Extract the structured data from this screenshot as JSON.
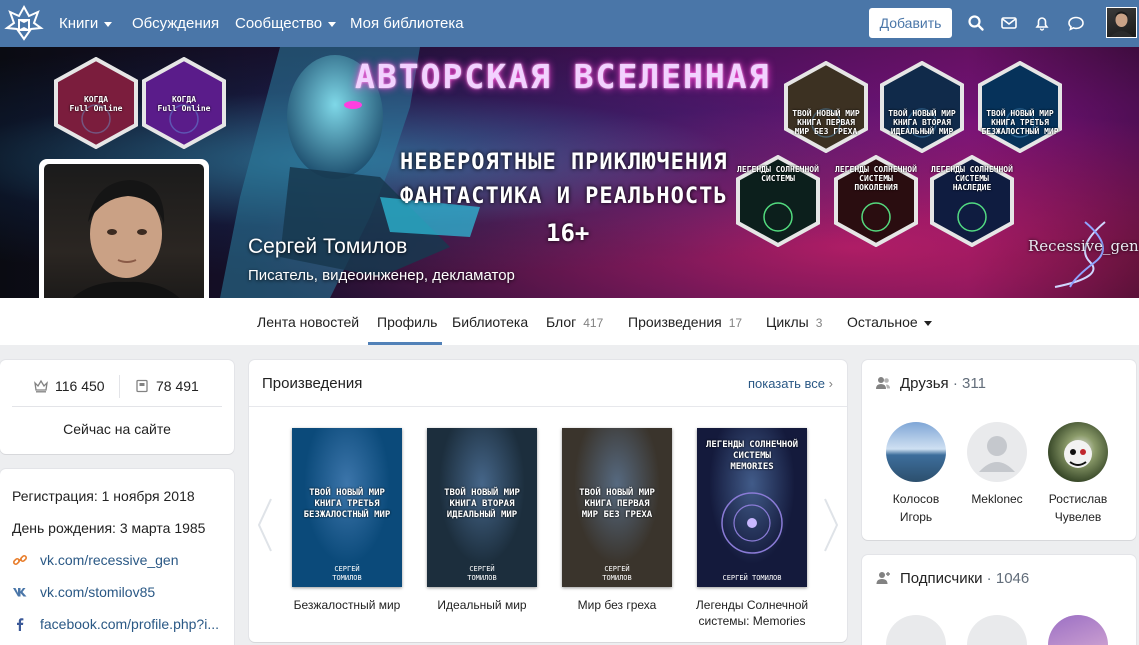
{
  "nav": {
    "items": [
      {
        "label": "Книги",
        "dropdown": true
      },
      {
        "label": "Обсуждения",
        "dropdown": false
      },
      {
        "label": "Сообщество",
        "dropdown": true
      },
      {
        "label": "Моя библиотека",
        "dropdown": false
      }
    ],
    "add_label": "Добавить",
    "icons": [
      "search-icon",
      "mail-icon",
      "bell-icon",
      "chat-icon"
    ]
  },
  "cover": {
    "title": "АВТОРСКАЯ ВСЕЛЕННАЯ",
    "subtitle_1": "НЕВЕРОЯТНЫЕ ПРИКЛЮЧЕНИЯ",
    "subtitle_2": "ФАНТАСТИКА И РЕАЛЬНОСТЬ",
    "age": "16+",
    "watermark": "Recessive_gen",
    "hexes": [
      {
        "label": "КОГДА\nFull Online"
      },
      {
        "label": "КОГДА\nFull Online"
      },
      {
        "label": "ТВОЙ НОВЫЙ МИР\nКНИГА ПЕРВАЯ\nМИР БЕЗ ГРЕХА"
      },
      {
        "label": "ТВОЙ НОВЫЙ МИР\nКНИГА ВТОРАЯ\nИДЕАЛЬНЫЙ МИР"
      },
      {
        "label": "ТВОЙ НОВЫЙ МИР\nКНИГА ТРЕТЬЯ\nБЕЗЖАЛОСТНЫЙ МИР"
      },
      {
        "label": "ЛЕГЕНДЫ СОЛНЕЧНОЙ\nСИСТЕМЫ"
      },
      {
        "label": "ЛЕГЕНДЫ СОЛНЕЧНОЙ\nСИСТЕМЫ\nПОКОЛЕНИЯ"
      },
      {
        "label": "ЛЕГЕНДЫ СОЛНЕЧНОЙ\nСИСТЕМЫ\nНАСЛЕДИЕ"
      }
    ]
  },
  "profile": {
    "name": "Сергей Томилов",
    "role": "Писатель, видеоинженер, декламатор"
  },
  "tabs": [
    {
      "label": "Лента новостей",
      "count": ""
    },
    {
      "label": "Профиль",
      "count": ""
    },
    {
      "label": "Библиотека",
      "count": ""
    },
    {
      "label": "Блог",
      "count": "417"
    },
    {
      "label": "Произведения",
      "count": "17"
    },
    {
      "label": "Циклы",
      "count": "3"
    },
    {
      "label": "Остальное",
      "count": ""
    }
  ],
  "stats": {
    "rating": "116 450",
    "books": "78 491",
    "status": "Сейчас на сайте"
  },
  "info": {
    "registration": "Регистрация: 1 ноября 2018",
    "birthday": "День рождения: 3 марта 1985",
    "links": [
      {
        "icon": "link-icon",
        "text": "vk.com/recessive_gen"
      },
      {
        "icon": "vk-icon",
        "text": "vk.com/stomilov85"
      },
      {
        "icon": "facebook-icon",
        "text": "facebook.com/profile.php?i..."
      }
    ]
  },
  "works": {
    "title": "Произведения",
    "show_all": "показать все",
    "books": [
      {
        "cover_title": "ТВОЙ НОВЫЙ МИР\nКНИГА ТРЕТЬЯ\nБЕЗЖАЛОСТНЫЙ МИР",
        "author": "СЕРГЕЙ\nТОМИЛОВ",
        "caption": "Безжалостный мир",
        "color": "#0b4a7a"
      },
      {
        "cover_title": "ТВОЙ НОВЫЙ МИР\nКНИГА ВТОРАЯ\nИДЕАЛЬНЫЙ МИР",
        "author": "СЕРГЕЙ\nТОМИЛОВ",
        "caption": "Идеальный мир",
        "color": "#1c2e3d"
      },
      {
        "cover_title": "ТВОЙ НОВЫЙ МИР\nКНИГА ПЕРВАЯ\nМИР БЕЗ ГРЕХА",
        "author": "СЕРГЕЙ\nТОМИЛОВ",
        "caption": "Мир без греха",
        "color": "#3a342c"
      },
      {
        "cover_title": "ЛЕГЕНДЫ СОЛНЕЧНОЙ\nСИСТЕМЫ\nMEMORIES",
        "author": "СЕРГЕЙ ТОМИЛОВ",
        "caption": "Легенды Солнечной системы: Memories",
        "color": "#141a3c"
      }
    ]
  },
  "friends": {
    "title": "Друзья",
    "count": "311",
    "items": [
      {
        "name": "Колосов Игорь"
      },
      {
        "name": "Meklonec"
      },
      {
        "name": "Ростислав Чувелев"
      }
    ]
  },
  "subscribers": {
    "title": "Подписчики",
    "count": "1046"
  },
  "colors": {
    "brand": "#4a76a8",
    "link": "#2a5885",
    "tab_active": "#5181b8"
  }
}
